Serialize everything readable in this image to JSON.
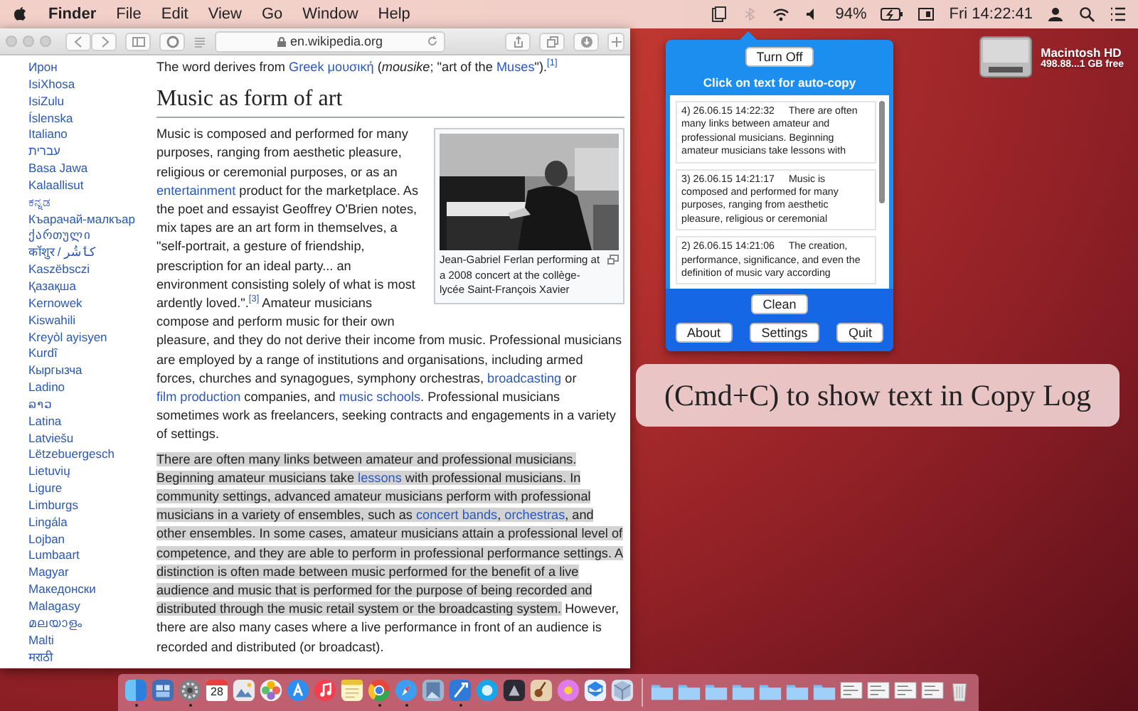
{
  "menu_bar": {
    "app_name": "Finder",
    "menus": [
      "File",
      "Edit",
      "View",
      "Go",
      "Window",
      "Help"
    ],
    "battery": "94%",
    "clock": "Fri 14:22:41"
  },
  "browser": {
    "address": "en.wikipedia.org",
    "languages": [
      "Ирон",
      "IsiXhosa",
      "IsiZulu",
      "Íslenska",
      "Italiano",
      "עברית",
      "Basa Jawa",
      "Kalaallisut",
      "ಕನ್ನಡ",
      "Къарачай-малкъар",
      "ქართული",
      "कॉशुर / کٲشُر",
      "Kaszëbsczi",
      "Қазақша",
      "Kernowek",
      "Kiswahili",
      "Kreyòl ayisyen",
      "Kurdî",
      "Кыргызча",
      "Ladino",
      "ລາວ",
      "Latina",
      "Latviešu",
      "Lëtzebuergesch",
      "Lietuvių",
      "Ligure",
      "Limburgs",
      "Lingála",
      "Lojban",
      "Lumbaart",
      "Magyar",
      "Македонски",
      "Malagasy",
      "മലയാളം",
      "Malti",
      "मराठी"
    ],
    "intro": [
      {
        "kind": "text",
        "text": "The word derives from "
      },
      {
        "kind": "link",
        "text": "Greek μουσική"
      },
      {
        "kind": "text",
        "text": " ("
      },
      {
        "kind": "italic",
        "text": "mousike"
      },
      {
        "kind": "text",
        "text": "; \"art of the "
      },
      {
        "kind": "link",
        "text": "Muses"
      },
      {
        "kind": "text",
        "text": "\")."
      },
      {
        "kind": "ref",
        "text": "[1]"
      }
    ],
    "heading": "Music as form of art",
    "lead": [
      {
        "kind": "text",
        "text": "Music is composed and performed for many purposes, ranging from aesthetic pleasure, religious or ceremonial purposes, or as an "
      },
      {
        "kind": "link",
        "text": "entertainment"
      },
      {
        "kind": "text",
        "text": " product for the marketplace. As the poet and essayist Geoffrey O'Brien notes, mix tapes are an art form in themselves, a \"self-portrait, a gesture of friendship, prescription for an ideal party... an environment consisting solely of what is most ardently loved.\"."
      },
      {
        "kind": "ref",
        "text": "[3]"
      },
      {
        "kind": "text",
        "text": " Amateur musicians compose and perform music for their own"
      }
    ],
    "figure": {
      "caption": "Jean-Gabriel Ferlan performing at a 2008 concert at the collège-lycée Saint-François Xavier"
    },
    "paragraphs": [
      [
        {
          "kind": "text",
          "text": "pleasure, and they do not derive their income from music. Professional musicians are employed by a range of institutions and organisations, including armed forces, churches and synagogues, symphony orchestras, "
        },
        {
          "kind": "link",
          "text": "broadcasting"
        },
        {
          "kind": "text",
          "text": " or "
        },
        {
          "kind": "link",
          "text": "film production"
        },
        {
          "kind": "text",
          "text": " companies, and "
        },
        {
          "kind": "link",
          "text": "music schools"
        },
        {
          "kind": "text",
          "text": ". Professional musicians sometimes work as freelancers, seeking contracts and engagements in a variety of settings."
        }
      ],
      [
        {
          "kind": "text",
          "text": "There are often many links between amateur and professional musicians. Beginning amateur musicians take ",
          "highlighted": true
        },
        {
          "kind": "link",
          "text": "lessons",
          "highlighted": true
        },
        {
          "kind": "text",
          "text": " with professional musicians. In community settings, advanced amateur musicians perform with professional musicians in a variety of ensembles, such as ",
          "highlighted": true
        },
        {
          "kind": "link",
          "text": "concert bands",
          "highlighted": true
        },
        {
          "kind": "text",
          "text": ", ",
          "highlighted": true
        },
        {
          "kind": "link",
          "text": "orchestras",
          "highlighted": true
        },
        {
          "kind": "text",
          "text": ", and other ensembles. In some cases, amateur musicians attain a professional level of competence, and they are able to perform in professional performance settings. A distinction is often made between music performed for the benefit of a live audience and music that is performed for the purpose of being recorded and distributed through the music retail system or the broadcasting system.",
          "highlighted": true
        },
        {
          "kind": "text",
          "text": " However, there are also many cases where a live performance in front of an audience is recorded and distributed (or broadcast).",
          "highlighted": false
        }
      ]
    ]
  },
  "copy_log": {
    "toggle_button": "Turn Off",
    "hint": "Click on text for auto-copy",
    "entries": [
      {
        "header": "4) 26.06.15 14:22:32",
        "text": "There are often many links between amateur and professional musicians. Beginning amateur musicians take lessons with"
      },
      {
        "header": "3) 26.06.15 14:21:17",
        "text": "Music is composed and performed for many purposes, ranging from aesthetic pleasure, religious or ceremonial"
      },
      {
        "header": "2) 26.06.15 14:21:06",
        "text": "The creation, performance, significance, and even the definition of music vary according"
      }
    ],
    "clean_button": "Clean",
    "buttons": [
      "About",
      "Settings",
      "Quit"
    ]
  },
  "desktop": {
    "disk_name": "Macintosh HD",
    "disk_info": "498.88...1 GB free",
    "toast": "(Cmd+C) to show text in Copy Log"
  },
  "dock": {
    "calendar_date": "28",
    "apps": [
      {
        "running": true
      },
      {
        "running": false
      },
      {
        "running": true
      },
      {
        "running": false
      },
      {
        "running": false
      },
      {
        "running": false
      },
      {
        "running": false
      },
      {
        "running": false
      },
      {
        "running": false
      },
      {
        "running": true
      },
      {
        "running": true
      },
      {
        "running": false
      },
      {
        "running": true
      },
      {
        "running": false
      },
      {
        "running": false
      },
      {
        "running": false
      },
      {
        "running": false
      },
      {
        "running": false
      },
      {
        "running": false
      }
    ]
  }
}
